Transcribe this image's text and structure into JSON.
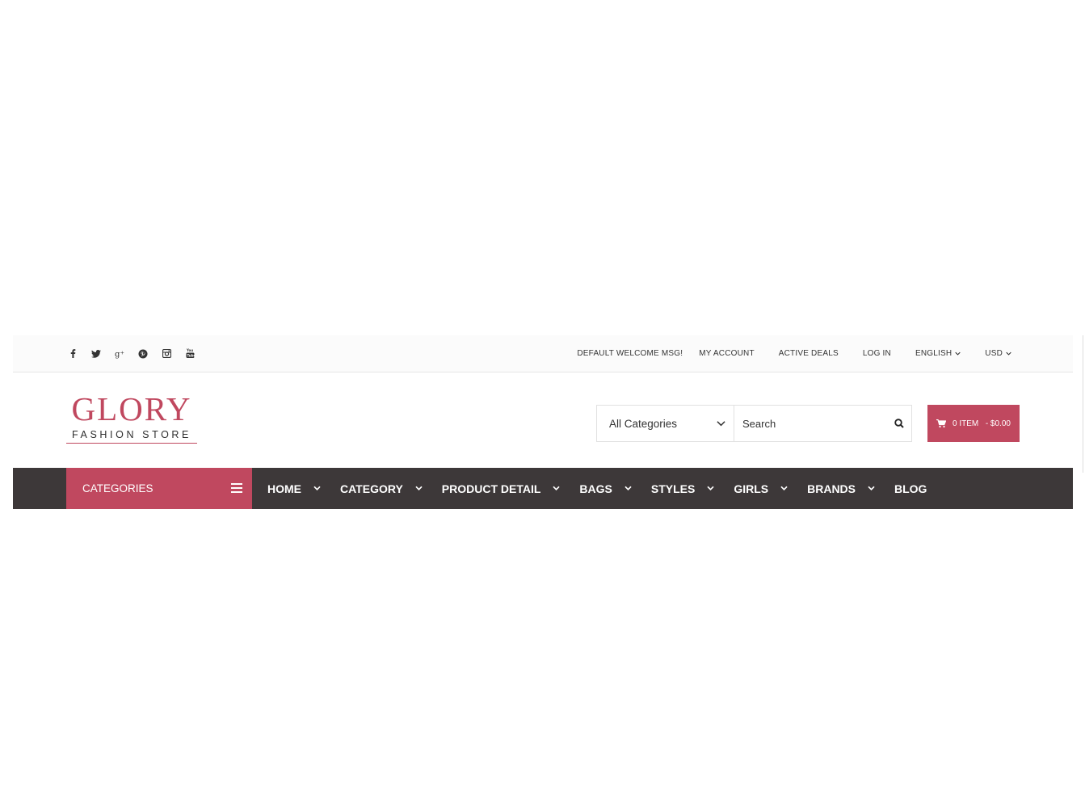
{
  "topbar": {
    "social_icons": [
      "facebook-icon",
      "twitter-icon",
      "google-plus-icon",
      "pinterest-icon",
      "instagram-icon",
      "youtube-icon"
    ],
    "welcome_msg": "DEFAULT WELCOME MSG!",
    "my_account": "MY ACCOUNT",
    "active_deals": "ACTIVE DEALS",
    "log_in": "LOG IN",
    "language": "ENGLISH",
    "currency": "USD"
  },
  "logo": {
    "title": "GLORY",
    "subtitle": "FASHION STORE"
  },
  "search": {
    "category_selected": "All Categories",
    "placeholder": "Search"
  },
  "cart": {
    "items": "0 ITEM",
    "total": "- $0.00"
  },
  "nav": {
    "categories_label": "CATEGORIES",
    "items": [
      {
        "label": "HOME",
        "has_dropdown": true
      },
      {
        "label": "CATEGORY",
        "has_dropdown": true
      },
      {
        "label": "PRODUCT DETAIL",
        "has_dropdown": true
      },
      {
        "label": "BAGS",
        "has_dropdown": true
      },
      {
        "label": "STYLES",
        "has_dropdown": true
      },
      {
        "label": "GIRLS",
        "has_dropdown": true
      },
      {
        "label": "BRANDS",
        "has_dropdown": true
      },
      {
        "label": "BLOG",
        "has_dropdown": false
      }
    ]
  },
  "colors": {
    "accent": "#c0485f",
    "nav_bg": "#3d3839",
    "topbar_bg": "#fbfbfb"
  }
}
